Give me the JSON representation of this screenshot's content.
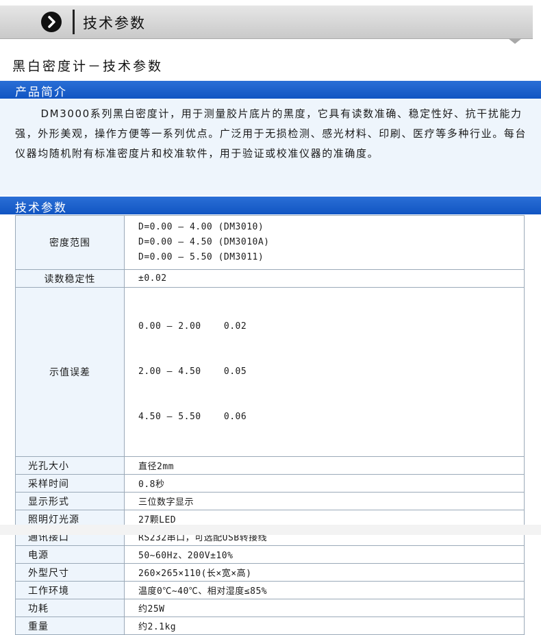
{
  "banner": {
    "title": "技术参数"
  },
  "heading": "黑白密度计－技术参数",
  "intro": {
    "label": "产品简介",
    "text": "DM3000系列黑白密度计，用于测量胶片底片的黑度，它具有读数准确、稳定性好、抗干扰能力强，外形美观，操作方便等一系列优点。广泛用于无损检测、感光材料、印刷、医疗等多种行业。每台仪器均随机附有标准密度片和校准软件，用于验证或校准仪器的准确度。"
  },
  "specs": {
    "label": "技术参数",
    "density_range": {
      "label": "密度范围",
      "lines": [
        "D=0.00 — 4.00 (DM3010)",
        "D=0.00 — 4.50 (DM3010A)",
        "D=0.00 — 5.50 (DM3011)"
      ]
    },
    "stability": {
      "label": "读数稳定性",
      "value": "±0.02"
    },
    "error": {
      "label": "示值误差",
      "lines": [
        "0.00 — 2.00    0.02",
        "2.00 — 4.50    0.05",
        "4.50 — 5.50    0.06"
      ]
    },
    "aperture": {
      "label": "光孔大小",
      "value": "直径2mm"
    },
    "sampling": {
      "label": "采样时间",
      "value": "0.8秒"
    },
    "display": {
      "label": "显示形式",
      "value": "三位数字显示"
    },
    "light": {
      "label": "照明灯光源",
      "value": "27颗LED"
    },
    "comm": {
      "label": "通讯接口",
      "value": "RS232串口，可选配USB转接线"
    },
    "power": {
      "label": "电源",
      "value": "50~60Hz、200V±10%"
    },
    "size": {
      "label": "外型尺寸",
      "value": "260×265×110(长×宽×高)"
    },
    "env": {
      "label": "工作环境",
      "value": "温度0℃~40℃、相对湿度≤85%"
    },
    "consumption": {
      "label": "功耗",
      "value": "约25W"
    },
    "weight": {
      "label": "重量",
      "value": "约2.1kg"
    }
  }
}
